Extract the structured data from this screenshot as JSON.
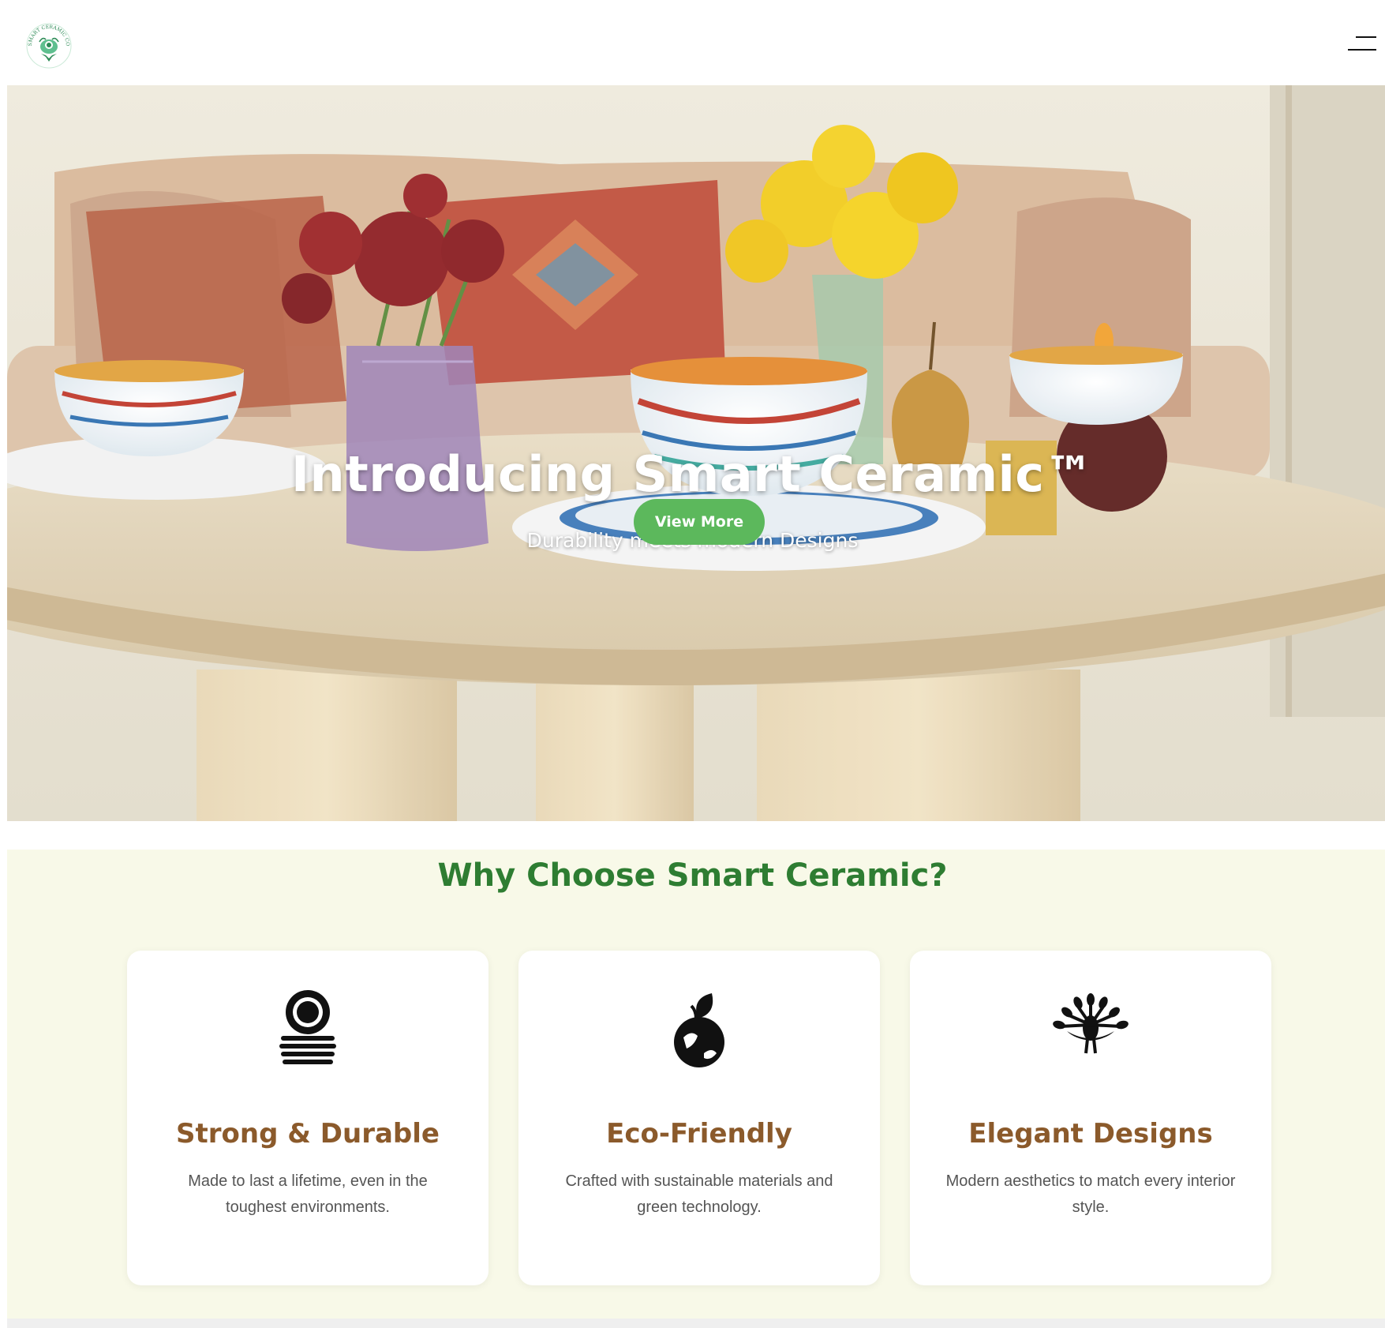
{
  "header": {
    "logo_text": "SMART CERAMIC CO",
    "menu_icon": "hamburger-menu-icon"
  },
  "hero": {
    "title": "Introducing Smart Ceramic™",
    "subtitle": "Durability meets modern Designs",
    "button_label": "View More"
  },
  "features": {
    "heading": "Why Choose Smart Ceramic?",
    "cards": [
      {
        "icon": "stacked-plates-icon",
        "title": "Strong & Durable",
        "description": "Made to last a lifetime, even in the toughest environments."
      },
      {
        "icon": "eco-globe-leaf-icon",
        "title": "Eco-Friendly",
        "description": "Crafted with sustainable materials and green technology."
      },
      {
        "icon": "peacock-icon",
        "title": "Elegant Designs",
        "description": "Modern aesthetics to match every interior style."
      }
    ]
  },
  "colors": {
    "accent_green": "#5cb85c",
    "heading_green": "#2e7d32",
    "card_title_brown": "#8b5a2b",
    "section_bg": "#f8f9e8"
  }
}
